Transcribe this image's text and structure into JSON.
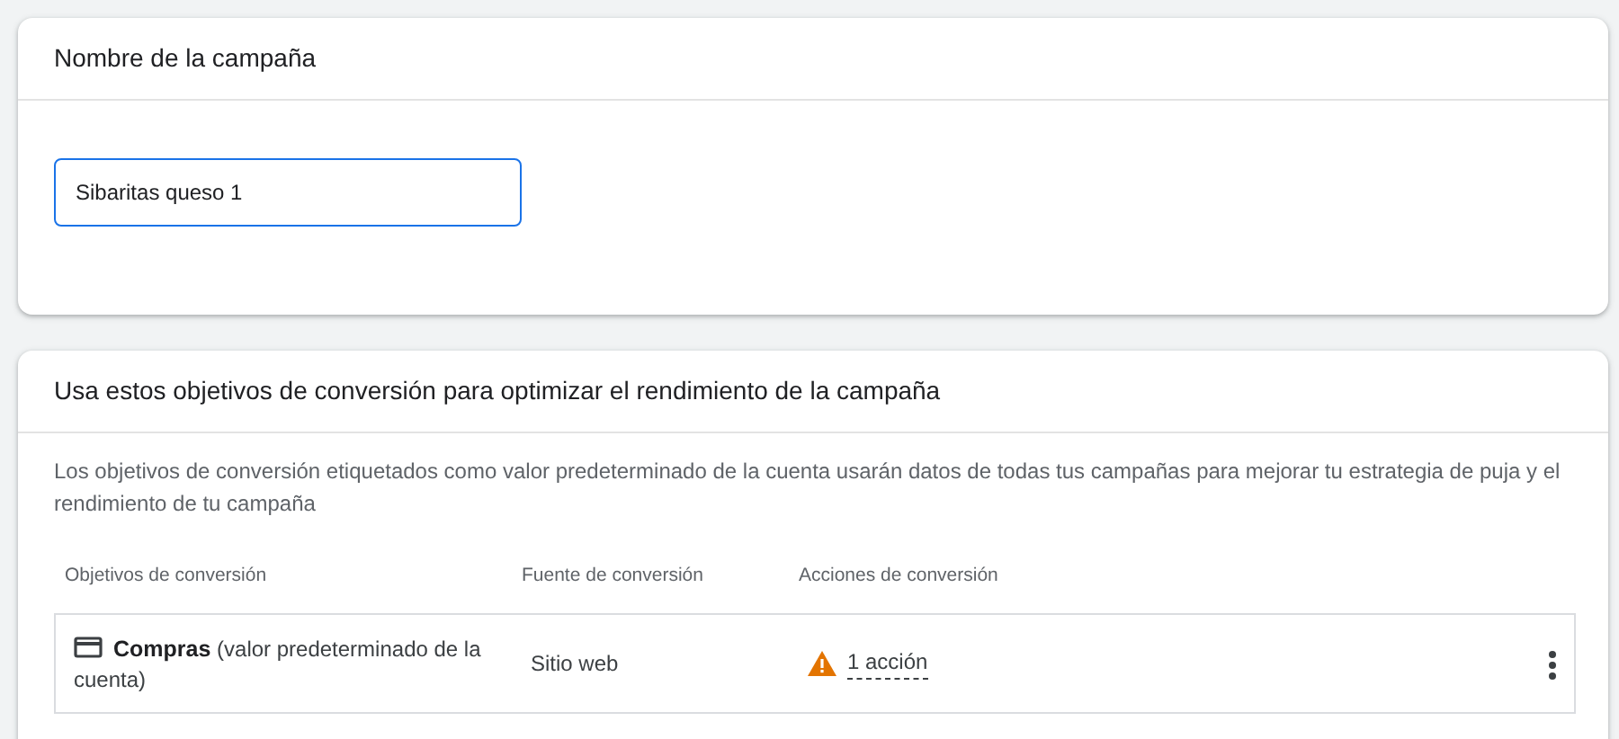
{
  "name_card": {
    "title": "Nombre de la campaña",
    "field": {
      "value": "Sibaritas queso 1"
    }
  },
  "goals_card": {
    "title": "Usa estos objetivos de conversión para optimizar el rendimiento de la campaña",
    "description": "Los objetivos de conversión etiquetados como valor predeterminado de la cuenta usarán datos de todas tus campañas para mejorar tu estrategia de puja y el rendimiento de tu campaña",
    "table": {
      "columns": [
        "Objetivos de conversión",
        "Fuente de conversión",
        "Acciones de conversión"
      ],
      "rows": [
        {
          "goal": "**Compras** (valor predeterminado de la cuenta)",
          "source": "Sitio web",
          "actions": "1 acción",
          "warning": true
        }
      ]
    }
  }
}
